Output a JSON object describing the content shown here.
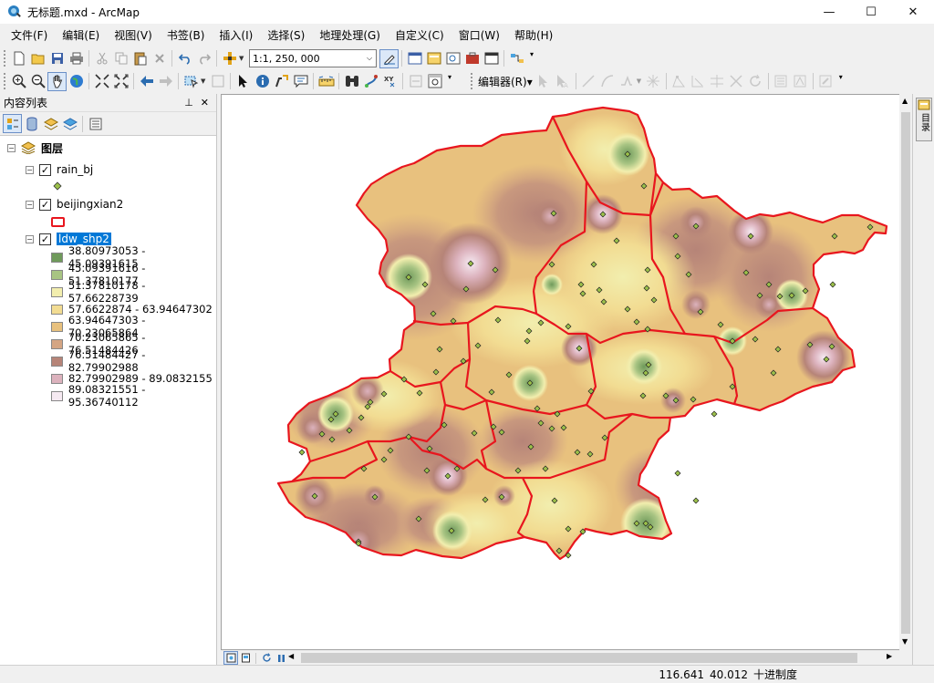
{
  "window": {
    "title": "无标题.mxd - ArcMap",
    "minimize_glyph": "—",
    "maximize_glyph": "☐",
    "close_glyph": "✕"
  },
  "menu": [
    "文件(F)",
    "编辑(E)",
    "视图(V)",
    "书签(B)",
    "插入(I)",
    "选择(S)",
    "地理处理(G)",
    "自定义(C)",
    "窗口(W)",
    "帮助(H)"
  ],
  "toolbar": {
    "scale_value": "1:1, 250, 000",
    "editor_label": "编辑器(R)▾"
  },
  "toc": {
    "title": "内容列表",
    "pin_glyph": "⊥",
    "close_glyph": "✕",
    "root_label": "图层",
    "layers": [
      {
        "name": "rain_bj",
        "checked": true
      },
      {
        "name": "beijingxian2",
        "checked": true
      },
      {
        "name": "ldw_shp2",
        "checked": true,
        "selected": true
      }
    ],
    "legend": [
      {
        "label": "38.80973053 - 45.09391615",
        "color": "#6f9a5b"
      },
      {
        "label": "45.09391616 - 51.37810177",
        "color": "#a8c483"
      },
      {
        "label": "51.37810178 - 57.66228739",
        "color": "#f2eeae"
      },
      {
        "label": "57.6622874 - 63.94647302",
        "color": "#f2dc92"
      },
      {
        "label": "63.94647303 - 70.23065864",
        "color": "#e8c17e"
      },
      {
        "label": "70.23065865 - 76.51484426",
        "color": "#d4a583"
      },
      {
        "label": "76.51484427 - 82.79902988",
        "color": "#b68478"
      },
      {
        "label": "82.79902989 - 89.0832155",
        "color": "#dcb2bd"
      },
      {
        "label": "89.08321551 - 95.36740112",
        "color": "#f6eaf2"
      }
    ]
  },
  "catalog_tab": {
    "label": "目录"
  },
  "status": {
    "x": "116.641",
    "y": "40.012",
    "units": "十进制度"
  },
  "colors": {
    "boundary": "#e8161e",
    "point_fill": "#9bc04a",
    "selection": "#0078d7"
  }
}
